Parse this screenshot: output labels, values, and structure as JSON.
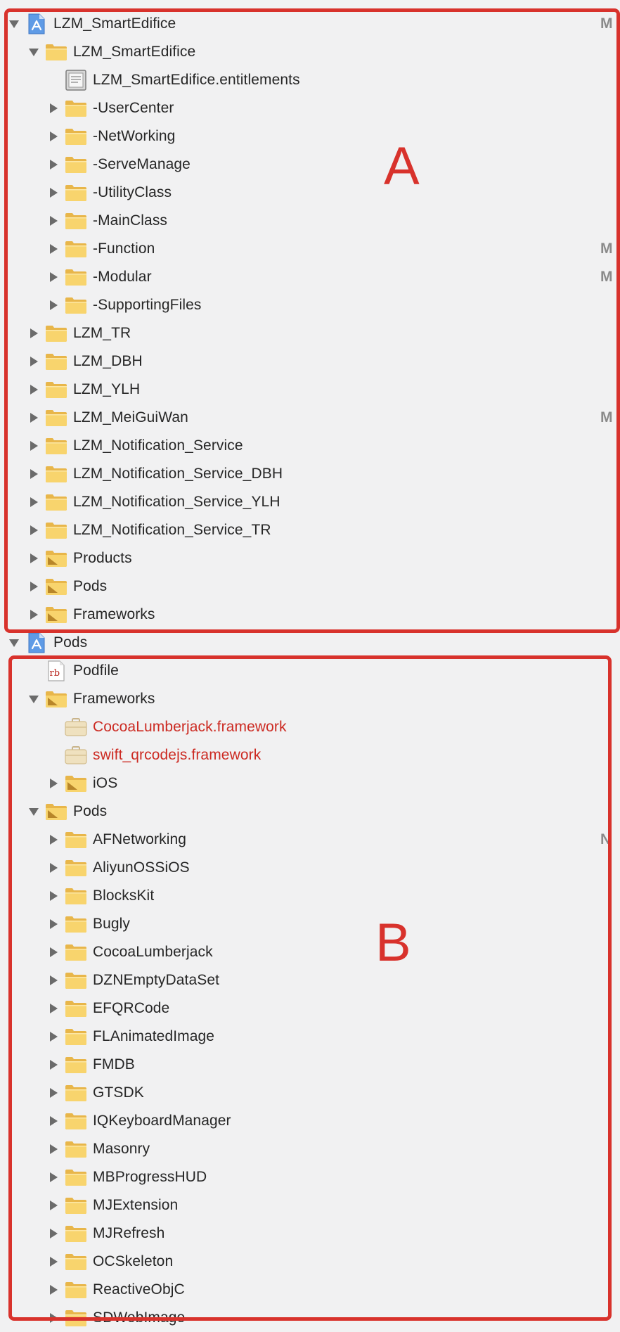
{
  "annotations": {
    "letter_a": "A",
    "letter_b": "B",
    "color": "#d8322c"
  },
  "badge_color": "#8a8a8a",
  "tree": [
    {
      "label": "LZM_SmartEdifice",
      "level": 0,
      "icon": "xcodeproj-icon",
      "disclosure": "expanded",
      "badge": "M"
    },
    {
      "label": "LZM_SmartEdifice",
      "level": 1,
      "icon": "folder-icon",
      "disclosure": "expanded"
    },
    {
      "label": "LZM_SmartEdifice.entitlements",
      "level": 2,
      "icon": "entitlements-file-icon",
      "disclosure": "none"
    },
    {
      "label": "-UserCenter",
      "level": 2,
      "icon": "folder-icon",
      "disclosure": "collapsed"
    },
    {
      "label": "-NetWorking",
      "level": 2,
      "icon": "folder-icon",
      "disclosure": "collapsed"
    },
    {
      "label": "-ServeManage",
      "level": 2,
      "icon": "folder-icon",
      "disclosure": "collapsed"
    },
    {
      "label": "-UtilityClass",
      "level": 2,
      "icon": "folder-icon",
      "disclosure": "collapsed"
    },
    {
      "label": "-MainClass",
      "level": 2,
      "icon": "folder-icon",
      "disclosure": "collapsed"
    },
    {
      "label": "-Function",
      "level": 2,
      "icon": "folder-icon",
      "disclosure": "collapsed",
      "badge": "M"
    },
    {
      "label": "-Modular",
      "level": 2,
      "icon": "folder-icon",
      "disclosure": "collapsed",
      "badge": "M"
    },
    {
      "label": "-SupportingFiles",
      "level": 2,
      "icon": "folder-icon",
      "disclosure": "collapsed"
    },
    {
      "label": "LZM_TR",
      "level": 1,
      "icon": "folder-icon",
      "disclosure": "collapsed"
    },
    {
      "label": "LZM_DBH",
      "level": 1,
      "icon": "folder-icon",
      "disclosure": "collapsed"
    },
    {
      "label": "LZM_YLH",
      "level": 1,
      "icon": "folder-icon",
      "disclosure": "collapsed"
    },
    {
      "label": "LZM_MeiGuiWan",
      "level": 1,
      "icon": "folder-icon",
      "disclosure": "collapsed",
      "badge": "M"
    },
    {
      "label": "LZM_Notification_Service",
      "level": 1,
      "icon": "folder-icon",
      "disclosure": "collapsed"
    },
    {
      "label": "LZM_Notification_Service_DBH",
      "level": 1,
      "icon": "folder-icon",
      "disclosure": "collapsed"
    },
    {
      "label": "LZM_Notification_Service_YLH",
      "level": 1,
      "icon": "folder-icon",
      "disclosure": "collapsed"
    },
    {
      "label": "LZM_Notification_Service_TR",
      "level": 1,
      "icon": "folder-icon",
      "disclosure": "collapsed"
    },
    {
      "label": "Products",
      "level": 1,
      "icon": "group-folder-icon",
      "disclosure": "collapsed"
    },
    {
      "label": "Pods",
      "level": 1,
      "icon": "group-folder-icon",
      "disclosure": "collapsed"
    },
    {
      "label": "Frameworks",
      "level": 1,
      "icon": "group-folder-icon",
      "disclosure": "collapsed"
    },
    {
      "label": "Pods",
      "level": 0,
      "icon": "xcodeproj-icon",
      "disclosure": "expanded"
    },
    {
      "label": "Podfile",
      "level": 1,
      "icon": "ruby-file-icon",
      "disclosure": "none"
    },
    {
      "label": "Frameworks",
      "level": 1,
      "icon": "group-folder-icon",
      "disclosure": "expanded"
    },
    {
      "label": "CocoaLumberjack.framework",
      "level": 2,
      "icon": "framework-icon",
      "disclosure": "none",
      "missing": true
    },
    {
      "label": "swift_qrcodejs.framework",
      "level": 2,
      "icon": "framework-icon",
      "disclosure": "none",
      "missing": true
    },
    {
      "label": "iOS",
      "level": 2,
      "icon": "group-folder-icon",
      "disclosure": "collapsed"
    },
    {
      "label": "Pods",
      "level": 1,
      "icon": "group-folder-icon",
      "disclosure": "expanded"
    },
    {
      "label": "AFNetworking",
      "level": 2,
      "icon": "folder-icon",
      "disclosure": "collapsed",
      "badge": "N"
    },
    {
      "label": "AliyunOSSiOS",
      "level": 2,
      "icon": "folder-icon",
      "disclosure": "collapsed"
    },
    {
      "label": "BlocksKit",
      "level": 2,
      "icon": "folder-icon",
      "disclosure": "collapsed"
    },
    {
      "label": "Bugly",
      "level": 2,
      "icon": "folder-icon",
      "disclosure": "collapsed"
    },
    {
      "label": "CocoaLumberjack",
      "level": 2,
      "icon": "folder-icon",
      "disclosure": "collapsed"
    },
    {
      "label": "DZNEmptyDataSet",
      "level": 2,
      "icon": "folder-icon",
      "disclosure": "collapsed"
    },
    {
      "label": "EFQRCode",
      "level": 2,
      "icon": "folder-icon",
      "disclosure": "collapsed"
    },
    {
      "label": "FLAnimatedImage",
      "level": 2,
      "icon": "folder-icon",
      "disclosure": "collapsed"
    },
    {
      "label": "FMDB",
      "level": 2,
      "icon": "folder-icon",
      "disclosure": "collapsed"
    },
    {
      "label": "GTSDK",
      "level": 2,
      "icon": "folder-icon",
      "disclosure": "collapsed"
    },
    {
      "label": "IQKeyboardManager",
      "level": 2,
      "icon": "folder-icon",
      "disclosure": "collapsed"
    },
    {
      "label": "Masonry",
      "level": 2,
      "icon": "folder-icon",
      "disclosure": "collapsed"
    },
    {
      "label": "MBProgressHUD",
      "level": 2,
      "icon": "folder-icon",
      "disclosure": "collapsed"
    },
    {
      "label": "MJExtension",
      "level": 2,
      "icon": "folder-icon",
      "disclosure": "collapsed"
    },
    {
      "label": "MJRefresh",
      "level": 2,
      "icon": "folder-icon",
      "disclosure": "collapsed"
    },
    {
      "label": "OCSkeleton",
      "level": 2,
      "icon": "folder-icon",
      "disclosure": "collapsed"
    },
    {
      "label": "ReactiveObjC",
      "level": 2,
      "icon": "folder-icon",
      "disclosure": "collapsed"
    },
    {
      "label": "SDWebImage",
      "level": 2,
      "icon": "folder-icon",
      "disclosure": "collapsed"
    }
  ]
}
